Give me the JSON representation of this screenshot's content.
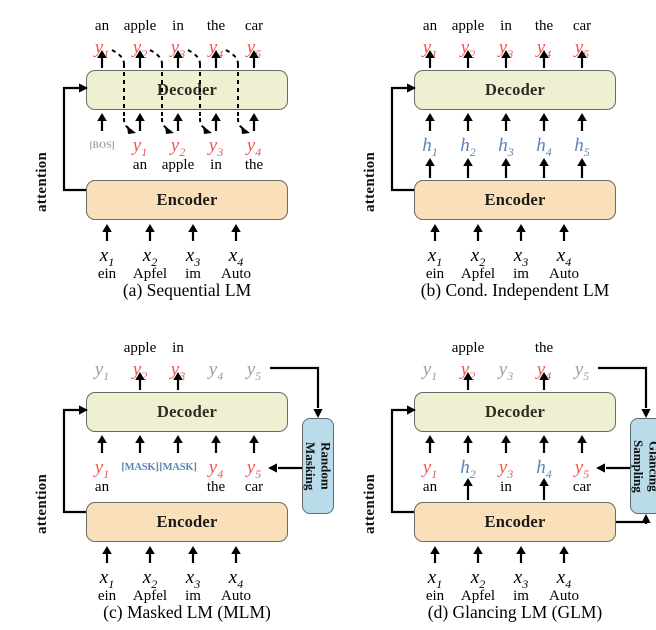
{
  "figure": {
    "panels": [
      {
        "id": "a",
        "caption": "(a) Sequential LM",
        "decoder_label": "Decoder",
        "encoder_label": "Encoder",
        "attention_label": "attention",
        "top_outputs": [
          {
            "sym": "y",
            "sub": "1",
            "color": "red",
            "word": "an"
          },
          {
            "sym": "y",
            "sub": "2",
            "color": "red",
            "word": "apple"
          },
          {
            "sym": "y",
            "sub": "3",
            "color": "red",
            "word": "in"
          },
          {
            "sym": "y",
            "sub": "4",
            "color": "red",
            "word": "the"
          },
          {
            "sym": "y",
            "sub": "5",
            "color": "red",
            "word": "car"
          }
        ],
        "decoder_inputs": [
          {
            "special": "[BOS]",
            "color": "gray",
            "word": ""
          },
          {
            "sym": "y",
            "sub": "1",
            "color": "red",
            "word": "an"
          },
          {
            "sym": "y",
            "sub": "2",
            "color": "red",
            "word": "apple"
          },
          {
            "sym": "y",
            "sub": "3",
            "color": "red",
            "word": "in"
          },
          {
            "sym": "y",
            "sub": "4",
            "color": "red",
            "word": "the"
          }
        ],
        "encoder_inputs": [
          {
            "sym": "x",
            "sub": "1",
            "color": "blk",
            "word": "ein"
          },
          {
            "sym": "x",
            "sub": "2",
            "color": "blk",
            "word": "Apfel"
          },
          {
            "sym": "x",
            "sub": "3",
            "color": "blk",
            "word": "im"
          },
          {
            "sym": "x",
            "sub": "4",
            "color": "blk",
            "word": "Auto"
          }
        ]
      },
      {
        "id": "b",
        "caption": "(b) Cond. Independent LM",
        "decoder_label": "Decoder",
        "encoder_label": "Encoder",
        "attention_label": "attention",
        "top_outputs": [
          {
            "sym": "y",
            "sub": "1",
            "color": "red",
            "word": "an"
          },
          {
            "sym": "y",
            "sub": "2",
            "color": "red",
            "word": "apple"
          },
          {
            "sym": "y",
            "sub": "3",
            "color": "red",
            "word": "in"
          },
          {
            "sym": "y",
            "sub": "4",
            "color": "red",
            "word": "the"
          },
          {
            "sym": "y",
            "sub": "5",
            "color": "red",
            "word": "car"
          }
        ],
        "decoder_inputs": [
          {
            "sym": "h",
            "sub": "1",
            "color": "blue",
            "word": ""
          },
          {
            "sym": "h",
            "sub": "2",
            "color": "blue",
            "word": ""
          },
          {
            "sym": "h",
            "sub": "3",
            "color": "blue",
            "word": ""
          },
          {
            "sym": "h",
            "sub": "4",
            "color": "blue",
            "word": ""
          },
          {
            "sym": "h",
            "sub": "5",
            "color": "blue",
            "word": ""
          }
        ],
        "encoder_inputs": [
          {
            "sym": "x",
            "sub": "1",
            "color": "blk",
            "word": "ein"
          },
          {
            "sym": "x",
            "sub": "2",
            "color": "blk",
            "word": "Apfel"
          },
          {
            "sym": "x",
            "sub": "3",
            "color": "blk",
            "word": "im"
          },
          {
            "sym": "x",
            "sub": "4",
            "color": "blk",
            "word": "Auto"
          }
        ]
      },
      {
        "id": "c",
        "caption": "(c) Masked LM (MLM)",
        "decoder_label": "Decoder",
        "encoder_label": "Encoder",
        "attention_label": "attention",
        "sidebox_label": "Random\nMasking",
        "top_outputs": [
          {
            "sym": "y",
            "sub": "1",
            "color": "gray",
            "word": ""
          },
          {
            "sym": "y",
            "sub": "2",
            "color": "red",
            "word": "apple"
          },
          {
            "sym": "y",
            "sub": "3",
            "color": "red",
            "word": "in"
          },
          {
            "sym": "y",
            "sub": "4",
            "color": "gray",
            "word": ""
          },
          {
            "sym": "y",
            "sub": "5",
            "color": "gray",
            "word": ""
          }
        ],
        "decoder_inputs": [
          {
            "sym": "y",
            "sub": "1",
            "color": "red",
            "word": "an"
          },
          {
            "special": "[MASK]",
            "color": "blue",
            "word": ""
          },
          {
            "special": "[MASK]",
            "color": "blue",
            "word": ""
          },
          {
            "sym": "y",
            "sub": "4",
            "color": "red",
            "word": "the"
          },
          {
            "sym": "y",
            "sub": "5",
            "color": "red",
            "word": "car"
          }
        ],
        "encoder_inputs": [
          {
            "sym": "x",
            "sub": "1",
            "color": "blk",
            "word": "ein"
          },
          {
            "sym": "x",
            "sub": "2",
            "color": "blk",
            "word": "Apfel"
          },
          {
            "sym": "x",
            "sub": "3",
            "color": "blk",
            "word": "im"
          },
          {
            "sym": "x",
            "sub": "4",
            "color": "blk",
            "word": "Auto"
          }
        ]
      },
      {
        "id": "d",
        "caption": "(d) Glancing LM (GLM)",
        "decoder_label": "Decoder",
        "encoder_label": "Encoder",
        "attention_label": "attention",
        "sidebox_label": "Glancing\nSampling",
        "top_outputs": [
          {
            "sym": "y",
            "sub": "1",
            "color": "gray",
            "word": ""
          },
          {
            "sym": "y",
            "sub": "2",
            "color": "red",
            "word": "apple"
          },
          {
            "sym": "y",
            "sub": "3",
            "color": "gray",
            "word": ""
          },
          {
            "sym": "y",
            "sub": "4",
            "color": "red",
            "word": "the"
          },
          {
            "sym": "y",
            "sub": "5",
            "color": "gray",
            "word": ""
          }
        ],
        "decoder_inputs": [
          {
            "sym": "y",
            "sub": "1",
            "color": "red",
            "word": "an"
          },
          {
            "sym": "h",
            "sub": "2",
            "color": "blue",
            "word": ""
          },
          {
            "sym": "y",
            "sub": "3",
            "color": "red",
            "word": "in"
          },
          {
            "sym": "h",
            "sub": "4",
            "color": "blue",
            "word": ""
          },
          {
            "sym": "y",
            "sub": "5",
            "color": "red",
            "word": "car"
          }
        ],
        "encoder_inputs": [
          {
            "sym": "x",
            "sub": "1",
            "color": "blk",
            "word": "ein"
          },
          {
            "sym": "x",
            "sub": "2",
            "color": "blk",
            "word": "Apfel"
          },
          {
            "sym": "x",
            "sub": "3",
            "color": "blk",
            "word": "im"
          },
          {
            "sym": "x",
            "sub": "4",
            "color": "blk",
            "word": "Auto"
          }
        ]
      }
    ],
    "colors": {
      "decoder_fill": "#eff0d2",
      "encoder_fill": "#fadfbb",
      "sidebox_fill": "#badbe9",
      "token_red": "#f0564f",
      "token_gray": "#9d9d9d",
      "token_blue": "#5d84b4",
      "box_border": "#6b6b63"
    }
  }
}
